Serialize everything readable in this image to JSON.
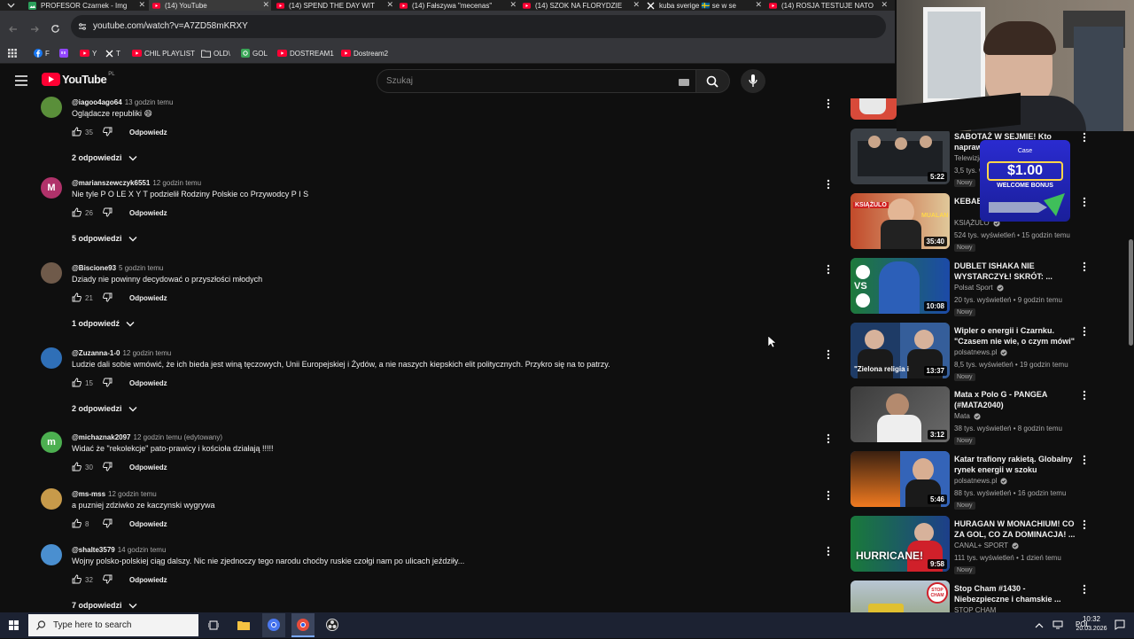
{
  "browser": {
    "tabs": [
      {
        "title": "PROFESOR Czarnek - Img",
        "icon": "image-icon",
        "color": "#2b9f5b",
        "active": false
      },
      {
        "title": "(14) YouTube",
        "icon": "youtube-icon",
        "color": "#ff0033",
        "active": true
      },
      {
        "title": "(14) SPEND THE DAY WIT",
        "icon": "youtube-icon",
        "color": "#ff0033",
        "active": false
      },
      {
        "title": "(14) Fałszywa \"mecenas\"",
        "icon": "youtube-icon",
        "color": "#ff0033",
        "active": false
      },
      {
        "title": "(14) SZOK NA FLORYDZIE",
        "icon": "youtube-icon",
        "color": "#ff0033",
        "active": false
      },
      {
        "title": "kuba sverige 🇸🇪 se w se",
        "icon": "x-icon",
        "color": "#ffffff",
        "active": false
      },
      {
        "title": "(14) ROSJA TESTUJE NATO",
        "icon": "youtube-icon",
        "color": "#ff0033",
        "active": false
      }
    ],
    "url": "youtube.com/watch?v=A7ZD58mKRXY",
    "bookmarks": [
      {
        "label": "F",
        "icon": "facebook-icon",
        "color": "#1877f2"
      },
      {
        "label": "",
        "icon": "twitch-icon",
        "color": "#9146ff"
      },
      {
        "label": "Y",
        "icon": "youtube-icon",
        "color": "#ff0033"
      },
      {
        "label": "T",
        "icon": "x-icon",
        "color": "#ffffff"
      },
      {
        "label": "CHIL PLAYLIST",
        "icon": "youtube-icon",
        "color": "#ff0033"
      },
      {
        "label": "OLD\\",
        "icon": "folder-icon",
        "color": "#cfcfcf"
      },
      {
        "label": "GOL",
        "icon": "gol-icon",
        "color": "#3aa657"
      },
      {
        "label": "DOSTREAM1",
        "icon": "youtube-icon",
        "color": "#ff0033"
      },
      {
        "label": "Dostream2",
        "icon": "youtube-icon",
        "color": "#ff0033"
      }
    ]
  },
  "youtube": {
    "logo_text": "YouTube",
    "logo_region": "PL",
    "search_placeholder": "Szukaj"
  },
  "comments": [
    {
      "handle": "@iagoo4ago64",
      "time": "13 godzin temu",
      "text": "Oglądacze republiki 😄",
      "likes": "35",
      "reply_label": "Odpowiedz",
      "replies": "2 odpowiedzi",
      "avatar_letter": "",
      "avatar_color": "#5a8f3a"
    },
    {
      "handle": "@marianszewczyk6551",
      "time": "12 godzin temu",
      "text": "Nie tyle P O LE X Y T podzielił Rodziny Polskie co Przywodcy P I S",
      "likes": "26",
      "reply_label": "Odpowiedz",
      "replies": "5 odpowiedzi",
      "avatar_letter": "M",
      "avatar_color": "#b0326a"
    },
    {
      "handle": "@Biscione93",
      "time": "5 godzin temu",
      "text": "Dziady nie powinny decydować o przyszłości młodych",
      "likes": "21",
      "reply_label": "Odpowiedz",
      "replies": "1 odpowiedź",
      "avatar_letter": "",
      "avatar_color": "#6f5a4a"
    },
    {
      "handle": "@Zuzanna-1-0",
      "time": "12 godzin temu",
      "text": "Ludzie dali sobie wmówić, że ich bieda jest winą tęczowych, Unii Europejskiej i Żydów, a nie naszych kiepskich elit politycznych. Przykro się na to patrzy.",
      "likes": "15",
      "reply_label": "Odpowiedz",
      "replies": "2 odpowiedzi",
      "avatar_letter": "",
      "avatar_color": "#2f6fb7"
    },
    {
      "handle": "@michaznak2097",
      "time": "12 godzin temu (edytowany)",
      "text": "Widać  że \"rekolekcje\" pato-prawicy i kościoła działają !!!!!",
      "likes": "30",
      "reply_label": "Odpowiedz",
      "replies": "",
      "avatar_letter": "m",
      "avatar_color": "#4caf50"
    },
    {
      "handle": "@ms-mss",
      "time": "12 godzin temu",
      "text": "a puzniej zdziwko ze kaczynski wygrywa",
      "likes": "8",
      "reply_label": "Odpowiedz",
      "replies": "",
      "avatar_letter": "",
      "avatar_color": "#c79a4a"
    },
    {
      "handle": "@shalte3579",
      "time": "14 godzin temu",
      "text": "Wojny polsko-polskiej ciąg dalszy. Nic nie zjednoczy tego narodu choćby ruskie czołgi nam po ulicach jeździły...",
      "likes": "32",
      "reply_label": "Odpowiedz",
      "replies": "7 odpowiedzi",
      "avatar_letter": "",
      "avatar_color": "#4a8fd0"
    }
  ],
  "sidebar": [
    {
      "title": "SABOTAŻ W SEJMIE! Kto naprawdę ...",
      "channel": "Telewizja ...",
      "meta": "3,5 tys. wyświetleń",
      "badge": "Nowy",
      "duration": "5:22",
      "thumb_color": "#3a3f45",
      "verified": false
    },
    {
      "title": "KEBAB ... KSIĄŻULO",
      "channel": "KSIĄŻULO",
      "meta": "524 tys. wyświetleń • 15 godzin temu",
      "badge": "Nowy",
      "duration": "35:40",
      "thumb_color": "#b33b2a",
      "verified": true
    },
    {
      "title": "DUBLET ISHAKA NIE WYSTARCZYŁ! SKRÓT: ...",
      "channel": "Polsat Sport",
      "meta": "20 tys. wyświetleń • 9 godzin temu",
      "badge": "Nowy",
      "duration": "10:08",
      "thumb_color": "#1e4fa0",
      "verified": true
    },
    {
      "title": "Wipler o energii i Czarnku. \"Czasem nie wie, o czym mówi\"",
      "channel": "polsatnews.pl",
      "meta": "8,5 tys. wyświetleń • 19 godzin temu",
      "badge": "Nowy",
      "duration": "13:37",
      "thumb_color": "#2a4d80",
      "verified": true
    },
    {
      "title": "Mata x Polo G - PANGEA (#MATA2040)",
      "channel": "Mata",
      "meta": "38 tys. wyświetleń • 8 godzin temu",
      "badge": "Nowy",
      "duration": "3:12",
      "thumb_color": "#4a4a4a",
      "verified": true
    },
    {
      "title": "Katar trafiony rakietą. Globalny rynek energii w szoku",
      "channel": "polsatnews.pl",
      "meta": "88 tys. wyświetleń • 16 godzin temu",
      "badge": "Nowy",
      "duration": "5:46",
      "thumb_color": "#2f5fa8",
      "verified": true
    },
    {
      "title": "HURAGAN W MONACHIUM! CO ZA GOL, CO ZA DOMINACJA! ...",
      "channel": "CANAL+ SPORT",
      "meta": "111 tys. wyświetleń • 1 dzień temu",
      "badge": "Nowy",
      "duration": "9:58",
      "thumb_color": "#1d3f8a",
      "verified": true
    },
    {
      "title": "Stop Cham #1430 - Niebezpieczne i chamskie ...",
      "channel": "STOP CHAM",
      "meta": "",
      "badge": "",
      "duration": "",
      "thumb_color": "#7a8a9a",
      "verified": false
    }
  ],
  "thumb_captions": {
    "kebab": "KSIĄŻULO",
    "mualan": "MUALAN",
    "vs": "VS",
    "zielona": "\"Zielona religia i",
    "hurricane": "HURRICANE!",
    "stopcham": "STOP CHAM"
  },
  "ad": {
    "brand": "Case",
    "amount": "$1.00",
    "label": "WELCOME BONUS"
  },
  "taskbar": {
    "search_placeholder": "Type here to search",
    "lang": "POL",
    "time": "10:32",
    "date": "20.03.2026"
  }
}
